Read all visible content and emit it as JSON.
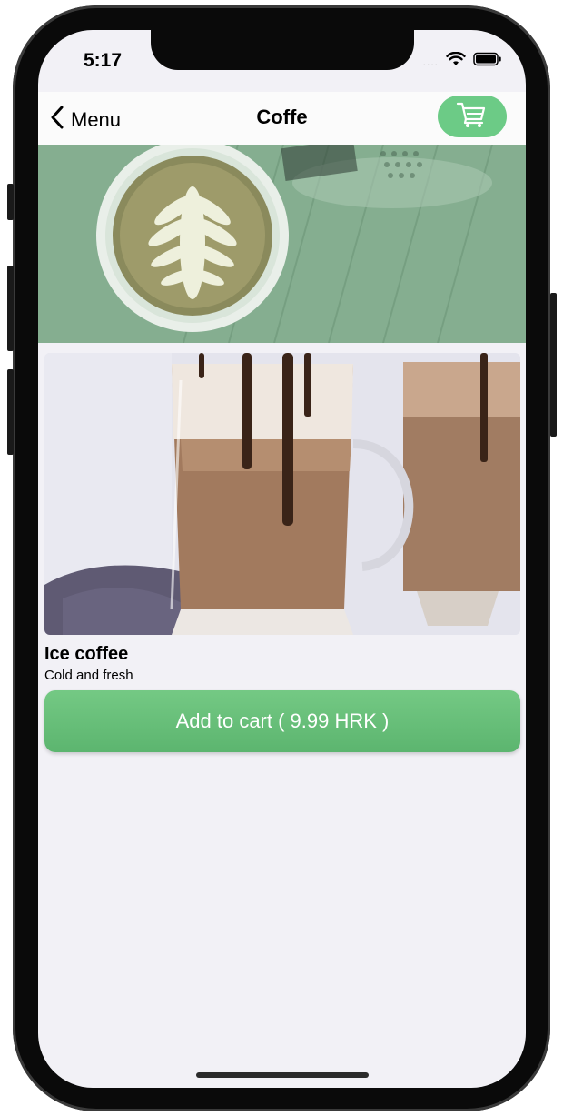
{
  "status_bar": {
    "time": "5:17",
    "signal_text": "....",
    "icons": [
      "wifi-icon",
      "battery-icon"
    ]
  },
  "nav": {
    "back_label": "Menu",
    "title": "Coffe",
    "cart_icon": "cart-icon"
  },
  "product": {
    "name": "Ice coffee",
    "description": "Cold and fresh",
    "button_label": "Add to cart ( 9.99 HRK )"
  },
  "colors": {
    "accent": "#6ccb86",
    "button_top": "#74c984",
    "button_bottom": "#5cb56f",
    "background": "#f2f1f6"
  }
}
